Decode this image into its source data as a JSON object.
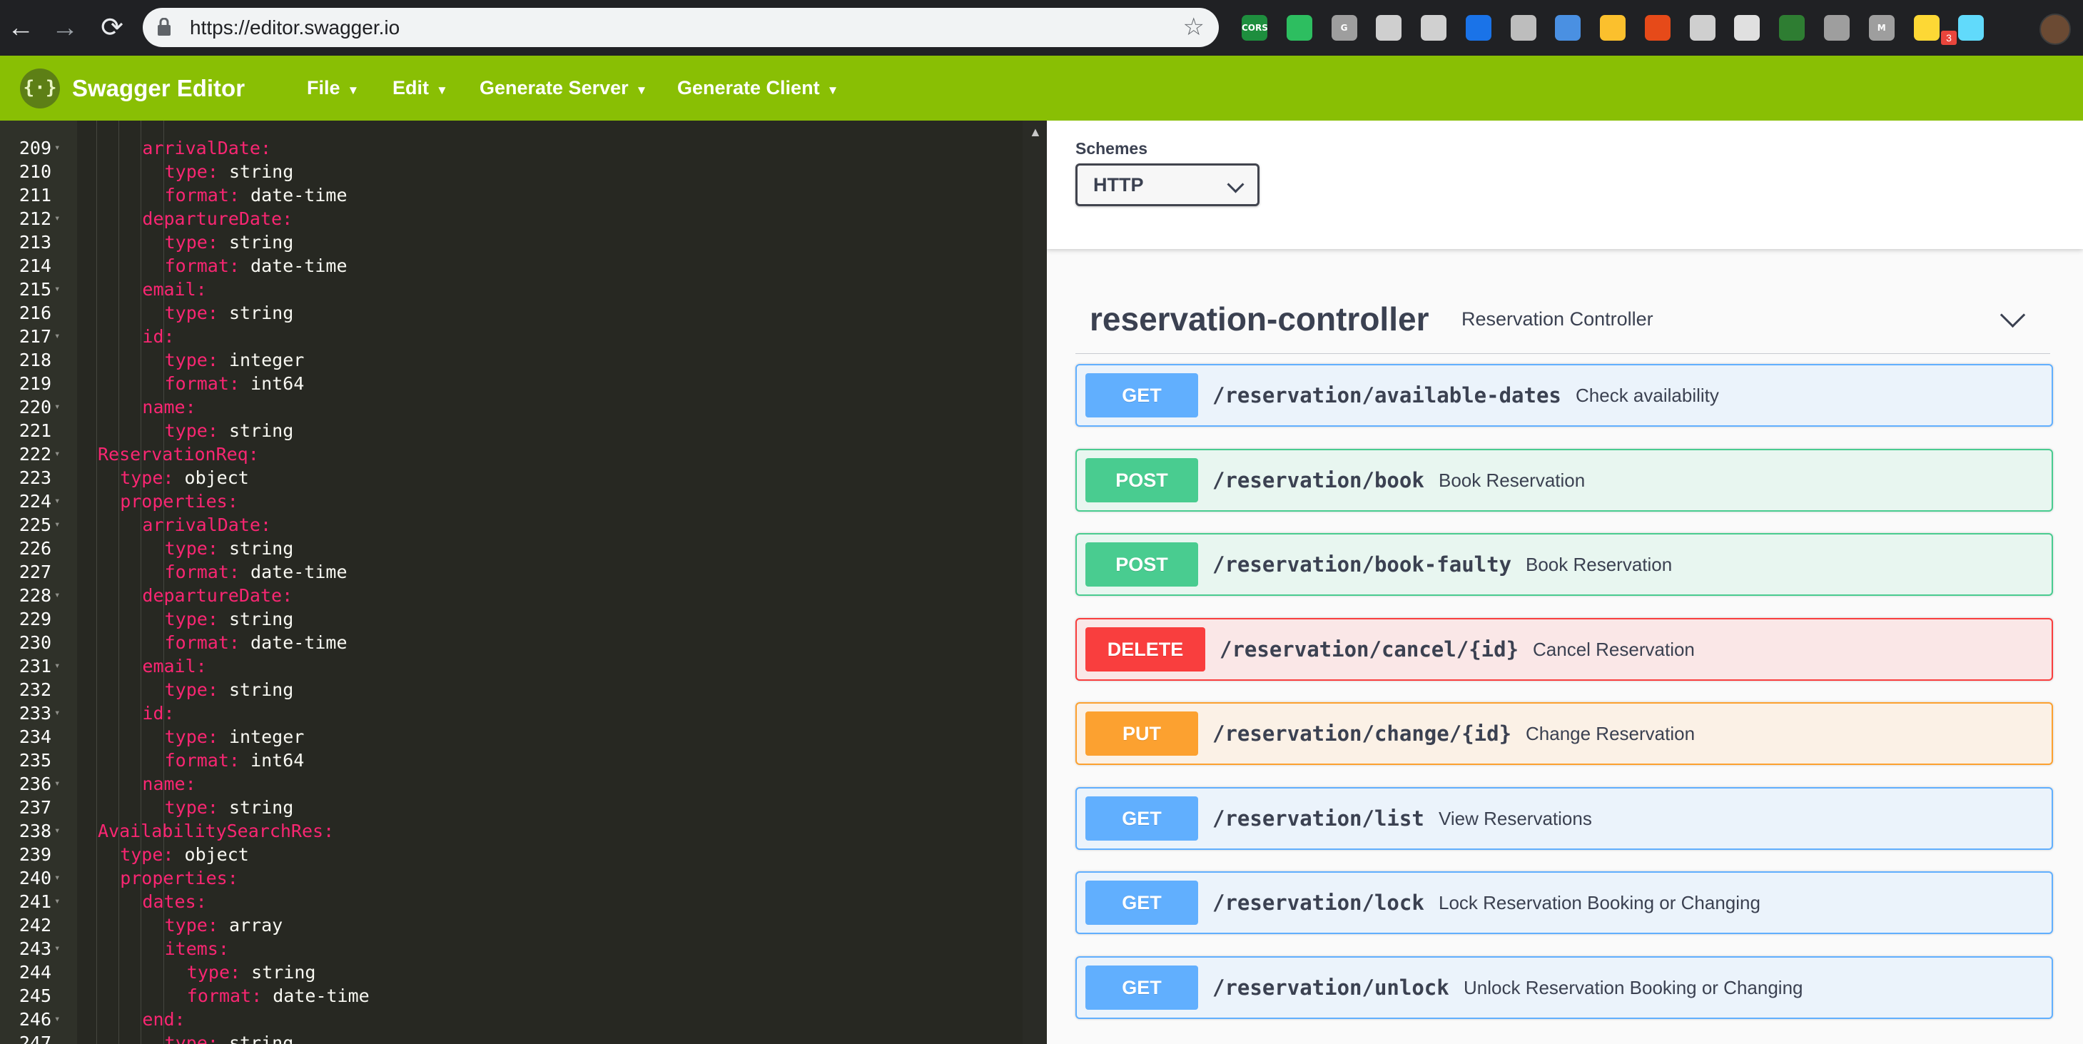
{
  "browser": {
    "url": "https://editor.swagger.io",
    "back_icon": "←",
    "forward_icon": "→",
    "reload_icon": "⟳",
    "star_icon": "☆",
    "extensions": [
      {
        "name": "cors-extension-icon",
        "label": "CORS",
        "color": "#1e8e3e"
      },
      {
        "name": "evernote-icon",
        "label": "",
        "color": "#2dbe60"
      },
      {
        "name": "grammar-icon",
        "label": "G",
        "color": "#9e9e9e"
      },
      {
        "name": "fox-icon",
        "label": "",
        "color": "#cfcfcf"
      },
      {
        "name": "circle-icon",
        "label": "",
        "color": "#d0d0d0"
      },
      {
        "name": "stack-icon",
        "label": "",
        "color": "#1a73e8"
      },
      {
        "name": "lightbulb-shield-icon",
        "label": "",
        "color": "#bdbdbd"
      },
      {
        "name": "timer-icon",
        "label": "",
        "color": "#4a90e2"
      },
      {
        "name": "moon-icon",
        "label": "",
        "color": "#fbc02d"
      },
      {
        "name": "owl-icon",
        "label": "",
        "color": "#e64a19"
      },
      {
        "name": "gear-icon",
        "label": "",
        "color": "#cfcfcf"
      },
      {
        "name": "document-icon",
        "label": "",
        "color": "#e0e0e0"
      },
      {
        "name": "target-icon",
        "label": "",
        "color": "#2e7d32"
      },
      {
        "name": "settings-icon",
        "label": "",
        "color": "#9e9e9e"
      },
      {
        "name": "m-icon",
        "label": "M",
        "color": "#9e9e9e"
      },
      {
        "name": "bulb-icon",
        "label": "",
        "color": "#fdd835"
      },
      {
        "name": "react-icon",
        "label": "",
        "color": "#61dafb"
      }
    ],
    "extension_badge": "3"
  },
  "topbar": {
    "logo_glyph": "{·}",
    "title": "Swagger Editor",
    "menu": [
      {
        "name": "menu-file",
        "label": "File",
        "caret": "▼"
      },
      {
        "name": "menu-edit",
        "label": "Edit",
        "caret": "▼"
      },
      {
        "name": "menu-generate-server",
        "label": "Generate Server",
        "caret": "▼"
      },
      {
        "name": "menu-generate-client",
        "label": "Generate Client",
        "caret": "▼"
      }
    ]
  },
  "editor": {
    "lines": [
      {
        "n": "209",
        "fold": true,
        "indent": 4,
        "key": "arrivalDate",
        "value": "",
        "kind": "container"
      },
      {
        "n": "210",
        "fold": false,
        "indent": 6,
        "key": "type",
        "value": "string",
        "kind": "pair"
      },
      {
        "n": "211",
        "fold": false,
        "indent": 6,
        "key": "format",
        "value": "date-time",
        "kind": "pair"
      },
      {
        "n": "212",
        "fold": true,
        "indent": 4,
        "key": "departureDate",
        "value": "",
        "kind": "container"
      },
      {
        "n": "213",
        "fold": false,
        "indent": 6,
        "key": "type",
        "value": "string",
        "kind": "pair"
      },
      {
        "n": "214",
        "fold": false,
        "indent": 6,
        "key": "format",
        "value": "date-time",
        "kind": "pair"
      },
      {
        "n": "215",
        "fold": true,
        "indent": 4,
        "key": "email",
        "value": "",
        "kind": "container"
      },
      {
        "n": "216",
        "fold": false,
        "indent": 6,
        "key": "type",
        "value": "string",
        "kind": "pair"
      },
      {
        "n": "217",
        "fold": true,
        "indent": 4,
        "key": "id",
        "value": "",
        "kind": "container"
      },
      {
        "n": "218",
        "fold": false,
        "indent": 6,
        "key": "type",
        "value": "integer",
        "kind": "pair"
      },
      {
        "n": "219",
        "fold": false,
        "indent": 6,
        "key": "format",
        "value": "int64",
        "kind": "pair"
      },
      {
        "n": "220",
        "fold": true,
        "indent": 4,
        "key": "name",
        "value": "",
        "kind": "container"
      },
      {
        "n": "221",
        "fold": false,
        "indent": 6,
        "key": "type",
        "value": "string",
        "kind": "pair"
      },
      {
        "n": "222",
        "fold": true,
        "indent": 0,
        "key": "ReservationReq",
        "value": "",
        "kind": "container"
      },
      {
        "n": "223",
        "fold": false,
        "indent": 2,
        "key": "type",
        "value": "object",
        "kind": "pair"
      },
      {
        "n": "224",
        "fold": true,
        "indent": 2,
        "key": "properties",
        "value": "",
        "kind": "container"
      },
      {
        "n": "225",
        "fold": true,
        "indent": 4,
        "key": "arrivalDate",
        "value": "",
        "kind": "container"
      },
      {
        "n": "226",
        "fold": false,
        "indent": 6,
        "key": "type",
        "value": "string",
        "kind": "pair"
      },
      {
        "n": "227",
        "fold": false,
        "indent": 6,
        "key": "format",
        "value": "date-time",
        "kind": "pair"
      },
      {
        "n": "228",
        "fold": true,
        "indent": 4,
        "key": "departureDate",
        "value": "",
        "kind": "container"
      },
      {
        "n": "229",
        "fold": false,
        "indent": 6,
        "key": "type",
        "value": "string",
        "kind": "pair"
      },
      {
        "n": "230",
        "fold": false,
        "indent": 6,
        "key": "format",
        "value": "date-time",
        "kind": "pair"
      },
      {
        "n": "231",
        "fold": true,
        "indent": 4,
        "key": "email",
        "value": "",
        "kind": "container"
      },
      {
        "n": "232",
        "fold": false,
        "indent": 6,
        "key": "type",
        "value": "string",
        "kind": "pair"
      },
      {
        "n": "233",
        "fold": true,
        "indent": 4,
        "key": "id",
        "value": "",
        "kind": "container"
      },
      {
        "n": "234",
        "fold": false,
        "indent": 6,
        "key": "type",
        "value": "integer",
        "kind": "pair"
      },
      {
        "n": "235",
        "fold": false,
        "indent": 6,
        "key": "format",
        "value": "int64",
        "kind": "pair"
      },
      {
        "n": "236",
        "fold": true,
        "indent": 4,
        "key": "name",
        "value": "",
        "kind": "container"
      },
      {
        "n": "237",
        "fold": false,
        "indent": 6,
        "key": "type",
        "value": "string",
        "kind": "pair"
      },
      {
        "n": "238",
        "fold": true,
        "indent": 0,
        "key": "AvailabilitySearchRes",
        "value": "",
        "kind": "container"
      },
      {
        "n": "239",
        "fold": false,
        "indent": 2,
        "key": "type",
        "value": "object",
        "kind": "pair"
      },
      {
        "n": "240",
        "fold": true,
        "indent": 2,
        "key": "properties",
        "value": "",
        "kind": "container"
      },
      {
        "n": "241",
        "fold": true,
        "indent": 4,
        "key": "dates",
        "value": "",
        "kind": "container"
      },
      {
        "n": "242",
        "fold": false,
        "indent": 6,
        "key": "type",
        "value": "array",
        "kind": "pair"
      },
      {
        "n": "243",
        "fold": true,
        "indent": 6,
        "key": "items",
        "value": "",
        "kind": "container"
      },
      {
        "n": "244",
        "fold": false,
        "indent": 8,
        "key": "type",
        "value": "string",
        "kind": "pair"
      },
      {
        "n": "245",
        "fold": false,
        "indent": 8,
        "key": "format",
        "value": "date-time",
        "kind": "pair"
      },
      {
        "n": "246",
        "fold": true,
        "indent": 4,
        "key": "end",
        "value": "",
        "kind": "container"
      },
      {
        "n": "247",
        "fold": false,
        "indent": 6,
        "key": "type",
        "value": "string",
        "kind": "pair"
      }
    ]
  },
  "schemes": {
    "label": "Schemes",
    "selected": "HTTP"
  },
  "tag": {
    "name": "reservation-controller",
    "description": "Reservation Controller"
  },
  "operations": [
    {
      "method": "GET",
      "path": "/reservation/available-dates",
      "summary": "Check availability",
      "style": "get"
    },
    {
      "method": "POST",
      "path": "/reservation/book",
      "summary": "Book Reservation",
      "style": "post"
    },
    {
      "method": "POST",
      "path": "/reservation/book-faulty",
      "summary": "Book Reservation",
      "style": "post"
    },
    {
      "method": "DELETE",
      "path": "/reservation/cancel/{id}",
      "summary": "Cancel Reservation",
      "style": "delete"
    },
    {
      "method": "PUT",
      "path": "/reservation/change/{id}",
      "summary": "Change Reservation",
      "style": "put"
    },
    {
      "method": "GET",
      "path": "/reservation/list",
      "summary": "View Reservations",
      "style": "get"
    },
    {
      "method": "GET",
      "path": "/reservation/lock",
      "summary": "Lock Reservation Booking or Changing",
      "style": "get"
    },
    {
      "method": "GET",
      "path": "/reservation/unlock",
      "summary": "Unlock Reservation Booking or Changing",
      "style": "get"
    }
  ],
  "colors": {
    "topbar": "#89bf04",
    "get": "#61affe",
    "post": "#49cc90",
    "delete": "#f93e3e",
    "put": "#fca130",
    "editor_bg": "#272822",
    "yaml_key": "#f92672"
  }
}
